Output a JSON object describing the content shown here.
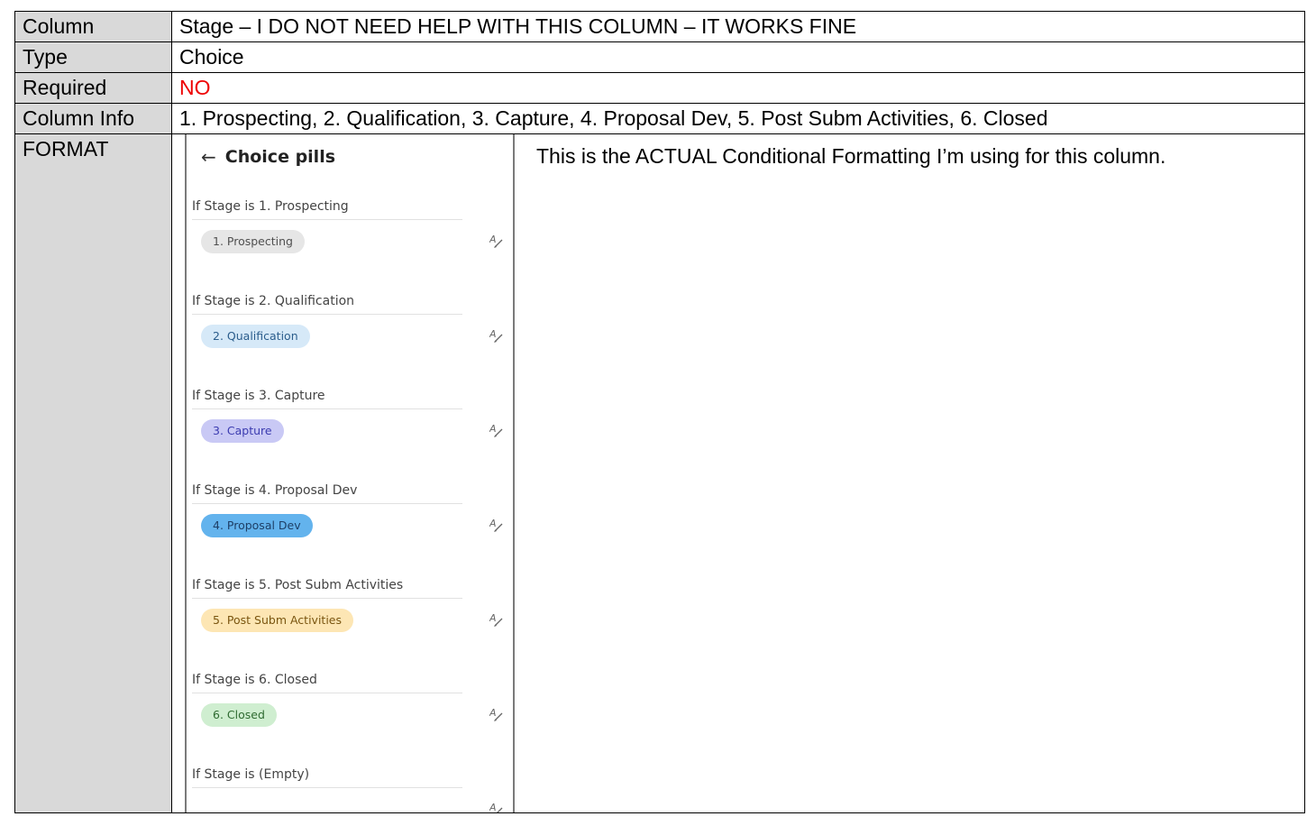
{
  "rows": {
    "column": {
      "label": "Column",
      "value": "Stage – I DO NOT NEED HELP WITH THIS COLUMN – IT WORKS FINE"
    },
    "type": {
      "label": "Type",
      "value": "Choice"
    },
    "required": {
      "label": "Required",
      "value": "NO",
      "value_color": "#ee0000"
    },
    "column_info": {
      "label": "Column Info",
      "value": "1. Prospecting, 2. Qualification, 3. Capture, 4. Proposal Dev, 5. Post Subm Activities, 6. Closed"
    },
    "format": {
      "label": "FORMAT"
    }
  },
  "panel": {
    "back_icon": "arrow-left-icon",
    "title": "Choice pills",
    "rules": [
      {
        "condition": "If Stage is 1. Prospecting",
        "pill": "1. Prospecting",
        "bg": "#e6e6e6",
        "fg": "#505050"
      },
      {
        "condition": "If Stage is 2. Qualification",
        "pill": "2. Qualification",
        "bg": "#d6e9f8",
        "fg": "#2b5d8c"
      },
      {
        "condition": "If Stage is 3. Capture",
        "pill": "3. Capture",
        "bg": "#c9c9f5",
        "fg": "#3b3bb0"
      },
      {
        "condition": "If Stage is 4. Proposal Dev",
        "pill": "4. Proposal Dev",
        "bg": "#63b3ed",
        "fg": "#1e3f66"
      },
      {
        "condition": "If Stage is 5. Post Subm Activities",
        "pill": "5. Post Subm Activities",
        "bg": "#fde6b4",
        "fg": "#7a5510"
      },
      {
        "condition": "If Stage is 6. Closed",
        "pill": "6. Closed",
        "bg": "#cfeed0",
        "fg": "#2f6b31"
      },
      {
        "condition": "If Stage is (Empty)",
        "pill": "",
        "bg": "",
        "fg": ""
      }
    ],
    "edit_icon": "edit-style-icon"
  },
  "format_note": "This is the ACTUAL Conditional Formatting I’m using for this column."
}
